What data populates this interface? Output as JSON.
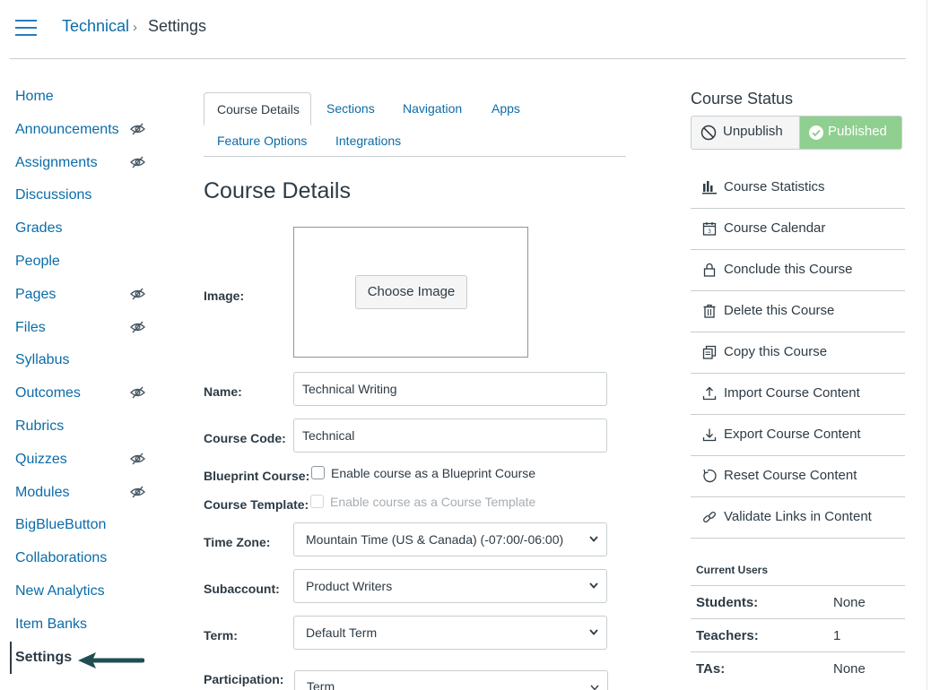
{
  "breadcrumb": {
    "course": "Technical",
    "current": "Settings"
  },
  "nav": [
    {
      "label": "Home",
      "hidden": false
    },
    {
      "label": "Announcements",
      "hidden": true
    },
    {
      "label": "Assignments",
      "hidden": true
    },
    {
      "label": "Discussions",
      "hidden": false
    },
    {
      "label": "Grades",
      "hidden": false
    },
    {
      "label": "People",
      "hidden": false
    },
    {
      "label": "Pages",
      "hidden": true
    },
    {
      "label": "Files",
      "hidden": true
    },
    {
      "label": "Syllabus",
      "hidden": false
    },
    {
      "label": "Outcomes",
      "hidden": true
    },
    {
      "label": "Rubrics",
      "hidden": false
    },
    {
      "label": "Quizzes",
      "hidden": true
    },
    {
      "label": "Modules",
      "hidden": true
    },
    {
      "label": "BigBlueButton",
      "hidden": false
    },
    {
      "label": "Collaborations",
      "hidden": false
    },
    {
      "label": "New Analytics",
      "hidden": false
    },
    {
      "label": "Item Banks",
      "hidden": false
    },
    {
      "label": "Settings",
      "hidden": false,
      "active": true
    }
  ],
  "tabs": {
    "course_details": "Course Details",
    "sections": "Sections",
    "navigation": "Navigation",
    "apps": "Apps",
    "feature_options": "Feature Options",
    "integrations": "Integrations"
  },
  "main": {
    "title": "Course Details",
    "image_label": "Image:",
    "choose_image": "Choose Image",
    "name_label": "Name:",
    "name_value": "Technical Writing",
    "code_label": "Course Code:",
    "code_value": "Technical",
    "blueprint_label": "Blueprint Course:",
    "blueprint_text": "Enable course as a Blueprint Course",
    "template_label": "Course Template:",
    "template_text": "Enable course as a Course Template",
    "timezone_label": "Time Zone:",
    "timezone_value": "Mountain Time (US & Canada) (-07:00/-06:00)",
    "subaccount_label": "Subaccount:",
    "subaccount_value": "Product Writers",
    "term_label": "Term:",
    "term_value": "Default Term",
    "participation_label": "Participation:",
    "participation_value": "Term"
  },
  "sidebar": {
    "status_title": "Course Status",
    "unpublish": "Unpublish",
    "published": "Published",
    "links": [
      {
        "label": "Course Statistics",
        "icon": "bar-chart-icon"
      },
      {
        "label": "Course Calendar",
        "icon": "calendar-icon"
      },
      {
        "label": "Conclude this Course",
        "icon": "lock-icon"
      },
      {
        "label": "Delete this Course",
        "icon": "trash-icon"
      },
      {
        "label": "Copy this Course",
        "icon": "copy-icon"
      },
      {
        "label": "Import Course Content",
        "icon": "upload-icon"
      },
      {
        "label": "Export Course Content",
        "icon": "download-icon"
      },
      {
        "label": "Reset Course Content",
        "icon": "reset-icon"
      },
      {
        "label": "Validate Links in Content",
        "icon": "link-icon"
      }
    ],
    "current_users_title": "Current Users",
    "users": [
      {
        "key": "Students:",
        "value": "None"
      },
      {
        "key": "Teachers:",
        "value": "1"
      },
      {
        "key": "TAs:",
        "value": "None"
      }
    ]
  },
  "colors": {
    "link": "#0b6ca8",
    "text": "#2d3b45",
    "published_bg": "#8fcf8f",
    "arrow": "#1f4e52"
  }
}
